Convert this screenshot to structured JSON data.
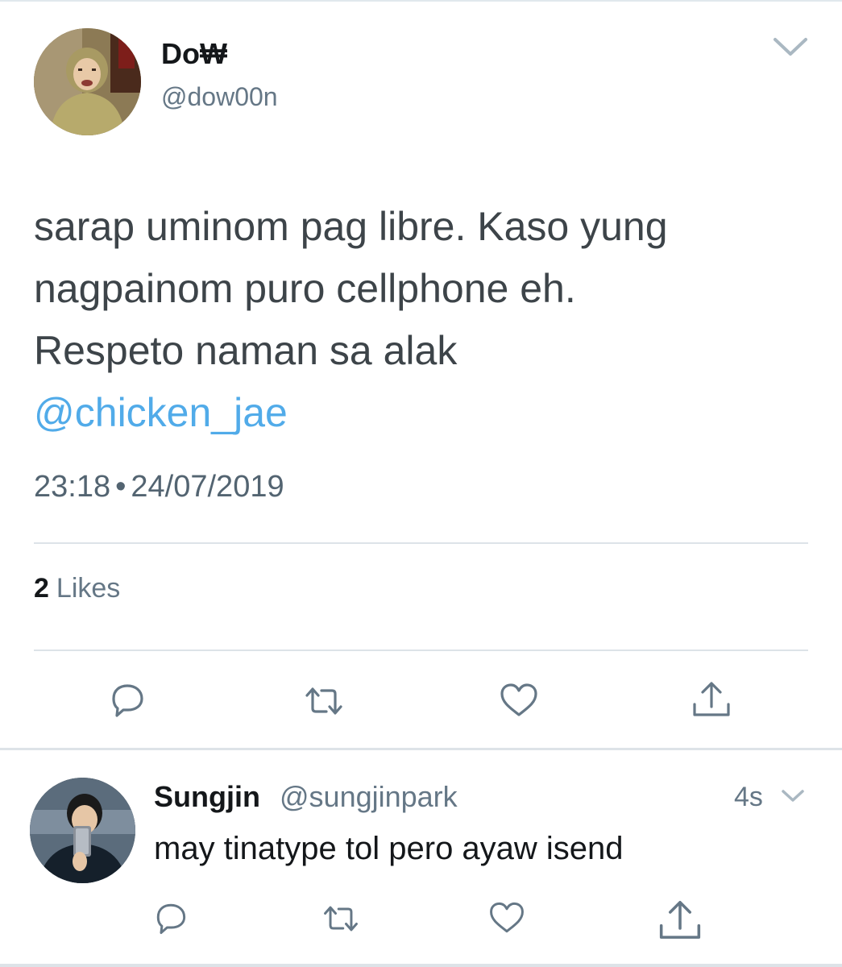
{
  "main_tweet": {
    "display_name": "Do₩",
    "handle": "@dow00n",
    "text_lines": [
      "sarap uminom pag libre. Kaso yung",
      "nagpainom puro cellphone eh.",
      "Respeto naman sa alak"
    ],
    "mention": "@chicken_jae",
    "time": "23:18",
    "separator": "•",
    "date": "24/07/2019",
    "likes_count": "2",
    "likes_label": "Likes",
    "icons": {
      "menu": "chevron-down-icon",
      "reply": "reply-icon",
      "retweet": "retweet-icon",
      "like": "heart-icon",
      "share": "share-icon"
    }
  },
  "reply_tweet": {
    "display_name": "Sungjin",
    "handle": "@sungjinpark",
    "time_ago": "4s",
    "text": "may tinatype tol pero ayaw isend"
  },
  "colors": {
    "link": "#51abe9",
    "text": "#3d4449",
    "secondary": "#657786",
    "icon": "#657786",
    "divider": "#dde3e8"
  }
}
